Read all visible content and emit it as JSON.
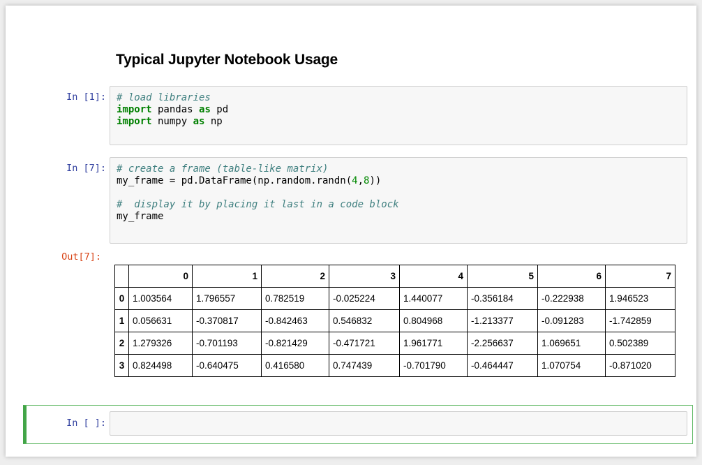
{
  "notebook": {
    "title": "Typical Jupyter Notebook Usage"
  },
  "cells": {
    "cell1": {
      "prompt": "In [1]:",
      "lines": [
        [
          {
            "t": "# load libraries",
            "c": "comment"
          }
        ],
        [
          {
            "t": "import",
            "c": "keyword"
          },
          {
            "t": " pandas ",
            "c": ""
          },
          {
            "t": "as",
            "c": "keyword"
          },
          {
            "t": " pd",
            "c": ""
          }
        ],
        [
          {
            "t": "import",
            "c": "keyword"
          },
          {
            "t": " numpy ",
            "c": ""
          },
          {
            "t": "as",
            "c": "keyword"
          },
          {
            "t": " np",
            "c": ""
          }
        ]
      ]
    },
    "cell2": {
      "prompt": "In [7]:",
      "lines": [
        [
          {
            "t": "# create a frame (table-like matrix)",
            "c": "comment"
          }
        ],
        [
          {
            "t": "my_frame = pd.DataFrame(np.random.randn(",
            "c": ""
          },
          {
            "t": "4",
            "c": "number"
          },
          {
            "t": ",",
            "c": ""
          },
          {
            "t": "8",
            "c": "number"
          },
          {
            "t": "))",
            "c": ""
          }
        ],
        [
          {
            "t": "",
            "c": ""
          }
        ],
        [
          {
            "t": "#  display it by placing it last in a code block",
            "c": "comment"
          }
        ],
        [
          {
            "t": "my_frame",
            "c": ""
          }
        ]
      ],
      "out_prompt": "Out[7]:",
      "table": {
        "columns": [
          "",
          "0",
          "1",
          "2",
          "3",
          "4",
          "5",
          "6",
          "7"
        ],
        "rows": [
          {
            "index": "0",
            "values": [
              "1.003564",
              "1.796557",
              "0.782519",
              "-0.025224",
              "1.440077",
              "-0.356184",
              "-0.222938",
              "1.946523"
            ]
          },
          {
            "index": "1",
            "values": [
              "0.056631",
              "-0.370817",
              "-0.842463",
              "0.546832",
              "0.804968",
              "-1.213377",
              "-0.091283",
              "-1.742859"
            ]
          },
          {
            "index": "2",
            "values": [
              "1.279326",
              "-0.701193",
              "-0.821429",
              "-0.471721",
              "1.961771",
              "-2.256637",
              "1.069651",
              "0.502389"
            ]
          },
          {
            "index": "3",
            "values": [
              "0.824498",
              "-0.640475",
              "0.416580",
              "0.747439",
              "-0.701790",
              "-0.464447",
              "1.070754",
              "-0.871020"
            ]
          }
        ]
      }
    },
    "cell3": {
      "prompt": "In [ ]:",
      "value": ""
    }
  },
  "colors": {
    "in_prompt": "#303f9f",
    "out_prompt": "#d84315",
    "selected_border": "#42a547",
    "comment": "#408080",
    "keyword": "#008000"
  }
}
